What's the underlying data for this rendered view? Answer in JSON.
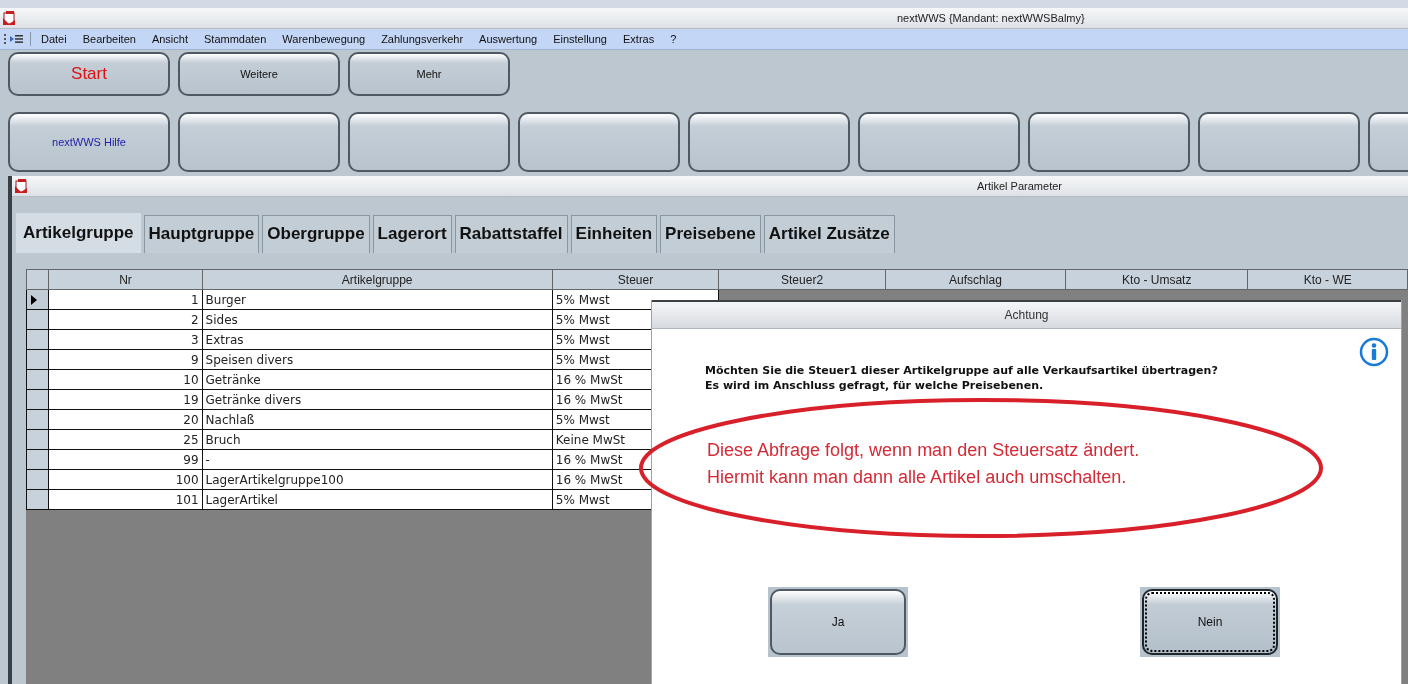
{
  "window": {
    "title": "nextWWS {Mandant: nextWWSBalmy}"
  },
  "menu": {
    "items": [
      {
        "label": "Datei"
      },
      {
        "label": "Bearbeiten"
      },
      {
        "label": "Ansicht"
      },
      {
        "label": "Stammdaten"
      },
      {
        "label": "Warenbewegung"
      },
      {
        "label": "Zahlungsverkehr"
      },
      {
        "label": "Auswertung"
      },
      {
        "label": "Einstellung"
      },
      {
        "label": "Extras"
      },
      {
        "label": "?"
      }
    ]
  },
  "toolbar_rows": [
    {
      "buttons": [
        {
          "kind": "start",
          "label": "Start"
        },
        {
          "kind": "plain",
          "label": "Weitere"
        },
        {
          "kind": "plain",
          "label": "Mehr"
        }
      ]
    },
    {
      "buttons": [
        {
          "kind": "link",
          "label": "nextWWS Hilfe"
        },
        {
          "kind": "blank"
        },
        {
          "kind": "blank"
        },
        {
          "kind": "blank"
        },
        {
          "kind": "blank"
        },
        {
          "kind": "blank"
        },
        {
          "kind": "blank"
        },
        {
          "kind": "blank"
        },
        {
          "kind": "blank"
        }
      ]
    }
  ],
  "inner_window": {
    "title": "Artikel Parameter",
    "tabs": [
      {
        "label": "Artikelgruppe",
        "selected": true
      },
      {
        "label": "Hauptgruppe",
        "selected": false
      },
      {
        "label": "Obergruppe",
        "selected": false
      },
      {
        "label": "Lagerort",
        "selected": false
      },
      {
        "label": "Rabattstaffel",
        "selected": false
      },
      {
        "label": "Einheiten",
        "selected": false
      },
      {
        "label": "Preisebene",
        "selected": false
      },
      {
        "label": "Artikel Zusätze",
        "selected": false
      }
    ],
    "table": {
      "columns": [
        "Nr",
        "Artikelgruppe",
        "Steuer",
        "Steuer2",
        "Aufschlag",
        "Kto - Umsatz",
        "Kto - WE"
      ],
      "rows": [
        {
          "nr": "1",
          "artikelgruppe": "Burger",
          "steuer": "5% Mwst",
          "current": true
        },
        {
          "nr": "2",
          "artikelgruppe": "Sides",
          "steuer": "5% Mwst",
          "current": false
        },
        {
          "nr": "3",
          "artikelgruppe": "Extras",
          "steuer": "5% Mwst",
          "current": false
        },
        {
          "nr": "9",
          "artikelgruppe": "Speisen divers",
          "steuer": "5% Mwst",
          "current": false
        },
        {
          "nr": "10",
          "artikelgruppe": "Getränke",
          "steuer": "16 % MwSt",
          "current": false
        },
        {
          "nr": "19",
          "artikelgruppe": "Getränke divers",
          "steuer": "16 % MwSt",
          "current": false
        },
        {
          "nr": "20",
          "artikelgruppe": "Nachlaß",
          "steuer": "5% Mwst",
          "current": false
        },
        {
          "nr": "25",
          "artikelgruppe": "Bruch",
          "steuer": "Keine MwSt",
          "current": false
        },
        {
          "nr": "99",
          "artikelgruppe": "-",
          "steuer": "16 % MwSt",
          "current": false
        },
        {
          "nr": "100",
          "artikelgruppe": "LagerArtikelgruppe100",
          "steuer": "16 % MwSt",
          "current": false
        },
        {
          "nr": "101",
          "artikelgruppe": "LagerArtikel",
          "steuer": "5% Mwst",
          "current": false
        }
      ]
    }
  },
  "dialog": {
    "title": "Achtung",
    "message": [
      "Möchten Sie die Steuer1 dieser Artikelgruppe auf alle Verkaufsartikel übertragen?",
      "Es wird im Anschluss gefragt, für welche Preisebenen."
    ],
    "buttons": [
      {
        "label": "Ja",
        "focused": false
      },
      {
        "label": "Nein",
        "focused": true
      }
    ]
  },
  "annotation": {
    "lines": [
      "Diese Abfrage folgt, wenn man den Steuersatz ändert.",
      "Hiermit kann man dann alle Artikel auch umschalten."
    ]
  }
}
